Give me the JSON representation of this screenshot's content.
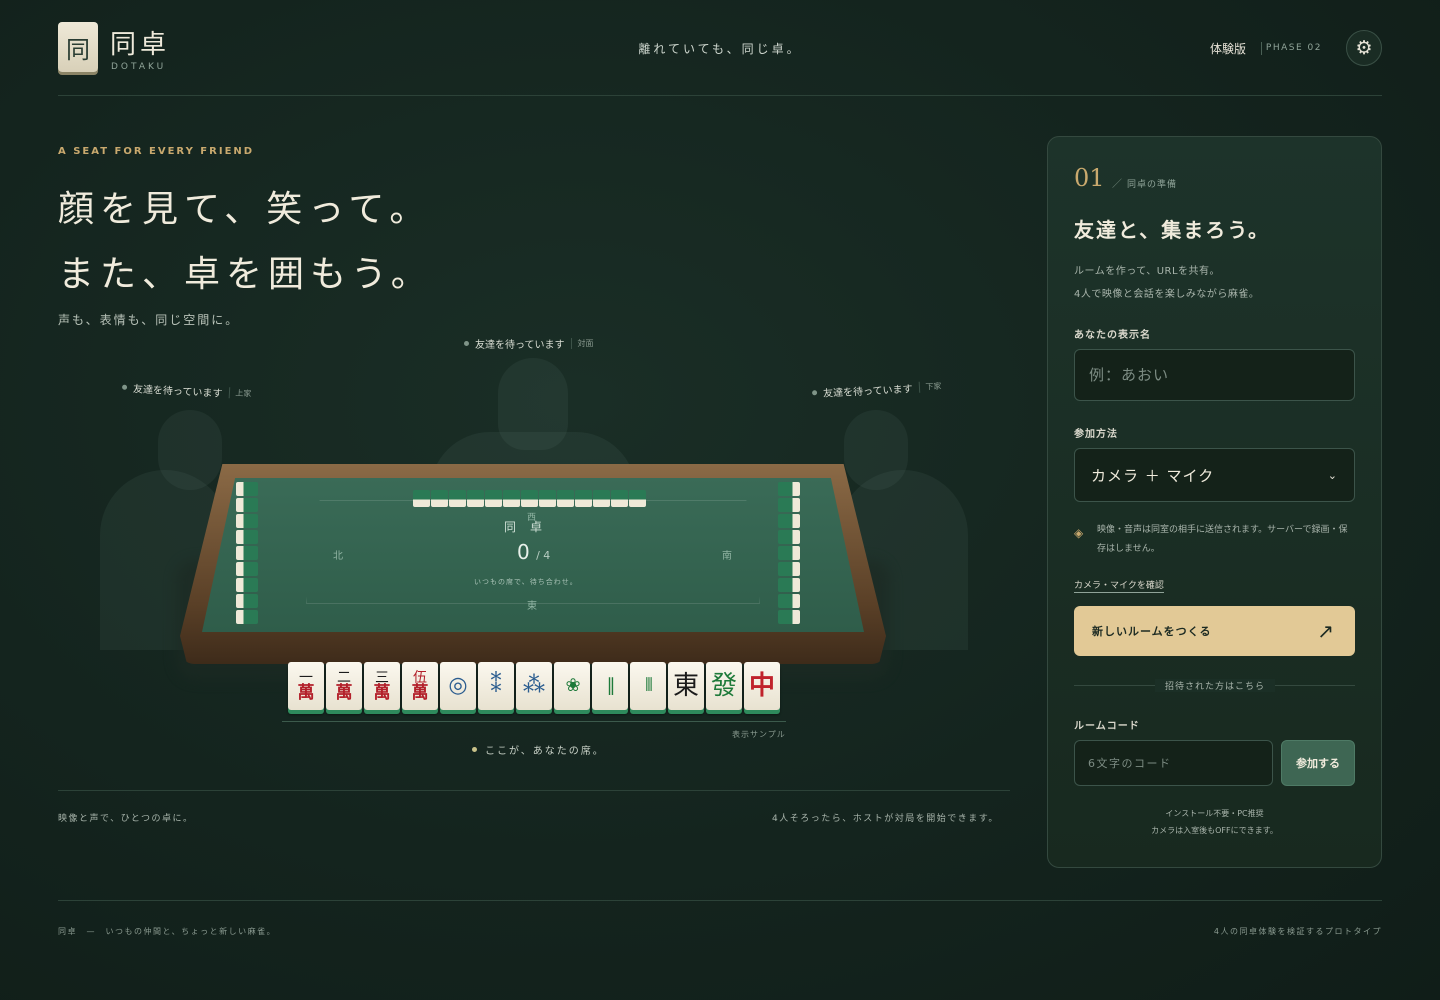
{
  "header": {
    "logo_glyph": "同",
    "logo_name": "同卓",
    "logo_sub": "DOTAKU",
    "tagline": "離れていても、同じ卓。",
    "edition": "体験版",
    "phase": "PHASE 02",
    "settings_icon": "gear-icon"
  },
  "hero": {
    "eyebrow": "A SEAT FOR EVERY FRIEND",
    "line1": "顔を見て、笑って。",
    "line2": "また、卓を囲もう。",
    "sub": "声も、表情も、同じ空間に。"
  },
  "seats": {
    "top": {
      "status": "友達を待っています",
      "position": "対面"
    },
    "left": {
      "status": "友達を待っています",
      "position": "上家"
    },
    "right": {
      "status": "友達を待っています",
      "position": "下家"
    }
  },
  "table": {
    "title": "同卓",
    "count": "0",
    "count_total": "/ 4",
    "note": "いつもの席で、待ち合わせ。",
    "winds": {
      "west": "西",
      "north": "北",
      "south": "南",
      "east": "東"
    }
  },
  "hand": {
    "tiles": [
      {
        "type": "man",
        "top": "一",
        "bottom": "萬"
      },
      {
        "type": "man",
        "top": "二",
        "bottom": "萬"
      },
      {
        "type": "man",
        "top": "三",
        "bottom": "萬"
      },
      {
        "type": "man",
        "top": "伍",
        "bottom": "萬",
        "red": true
      },
      {
        "type": "pin",
        "glyph": "◎"
      },
      {
        "type": "pin",
        "glyph": "⁑"
      },
      {
        "type": "pin",
        "glyph": "⁂"
      },
      {
        "type": "sou",
        "glyph": "❀"
      },
      {
        "type": "sou",
        "glyph": "‖"
      },
      {
        "type": "sou",
        "glyph": "⦀"
      },
      {
        "type": "honor",
        "glyph": "東",
        "color": "dark"
      },
      {
        "type": "honor",
        "glyph": "發",
        "color": "green"
      },
      {
        "type": "honor",
        "glyph": "中",
        "color": "red"
      }
    ],
    "sample_label": "表示サンプル",
    "my_seat": "ここが、あなたの席。"
  },
  "feature_footer": {
    "left": "映像と声で、ひとつの卓に。",
    "right": "4人そろったら、ホストが対局を開始できます。"
  },
  "panel": {
    "step_number": "01",
    "step_label": "同卓の準備",
    "title": "友達と、集まろう。",
    "desc_line1": "ルームを作って、URLを共有。",
    "desc_line2": "4人で映像と会話を楽しみながら麻雀。",
    "name_label": "あなたの表示名",
    "name_placeholder": "例：あおい",
    "mode_label": "参加方法",
    "mode_value": "カメラ ＋ マイク",
    "privacy_note": "映像・音声は同室の相手に送信されます。サーバーで録画・保存はしません。",
    "camera_check": "カメラ・マイクを確認",
    "create_button": "新しいルームをつくる",
    "create_arrow": "↗",
    "invited_divider": "招待された方はこちら",
    "code_label": "ルームコード",
    "code_placeholder": "6文字のコード",
    "join_button": "参加する",
    "note_line1": "インストール不要・PC推奨",
    "note_line2": "カメラは入室後もOFFにできます。"
  },
  "footer": {
    "left": "同卓　—　いつもの仲間と、ちょっと新しい麻雀。",
    "right": "4人の同卓体験を検証するプロトタイプ"
  }
}
